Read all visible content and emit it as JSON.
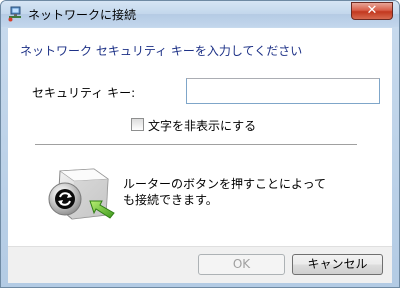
{
  "window": {
    "title": "ネットワークに接続",
    "close_glyph": "✕",
    "accent": "#1e3287"
  },
  "main": {
    "heading": "ネットワーク セキュリティ キーを入力してください",
    "key_label": "セキュリティ キー:",
    "key_value": "",
    "hide_chars_label": "文字を非表示にする",
    "hide_chars_checked": false,
    "router_line1": "ルーターのボタンを押すことによって",
    "router_line2": "も接続できます。",
    "router_icon": "router-push-button-icon"
  },
  "footer": {
    "ok_label": "OK",
    "ok_enabled": false,
    "cancel_label": "キャンセル"
  }
}
